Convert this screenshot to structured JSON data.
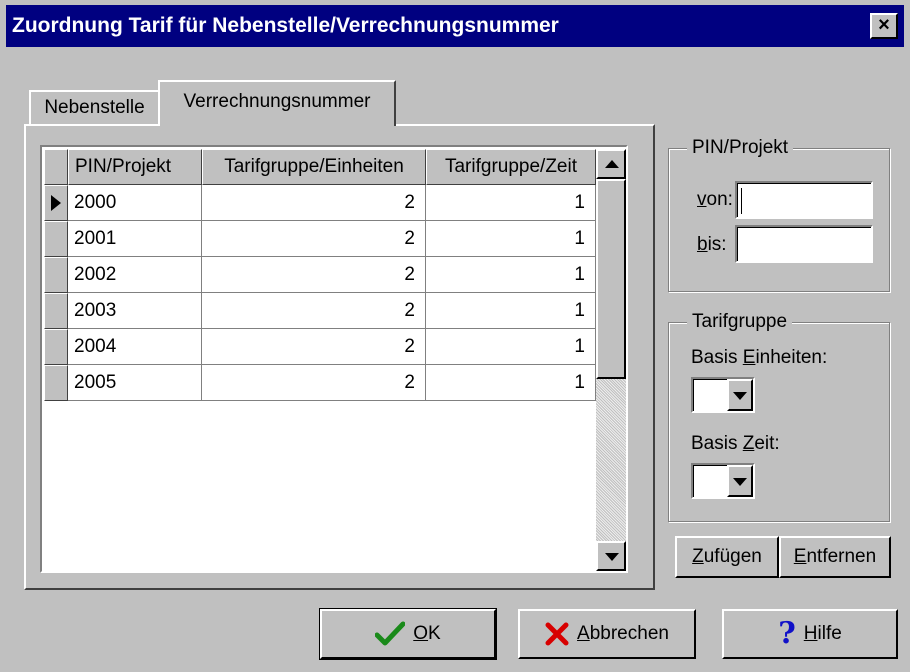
{
  "window": {
    "title": "Zuordnung Tarif für Nebenstelle/Verrechnungsnummer"
  },
  "tabs": [
    {
      "label": "Nebenstelle",
      "active": false
    },
    {
      "label": "Verrechnungsnummer",
      "active": true
    }
  ],
  "grid": {
    "columns": [
      "PIN/Projekt",
      "Tarifgruppe/Einheiten",
      "Tarifgruppe/Zeit"
    ],
    "rows": [
      {
        "pin": "2000",
        "einheiten": "2",
        "zeit": "1",
        "current": true
      },
      {
        "pin": "2001",
        "einheiten": "2",
        "zeit": "1",
        "current": false
      },
      {
        "pin": "2002",
        "einheiten": "2",
        "zeit": "1",
        "current": false
      },
      {
        "pin": "2003",
        "einheiten": "2",
        "zeit": "1",
        "current": false
      },
      {
        "pin": "2004",
        "einheiten": "2",
        "zeit": "1",
        "current": false
      },
      {
        "pin": "2005",
        "einheiten": "2",
        "zeit": "1",
        "current": false
      }
    ]
  },
  "pin_group": {
    "legend": "PIN/Projekt",
    "von": {
      "label_key": "v",
      "label_rest": "on:",
      "value": ""
    },
    "bis": {
      "label_key": "b",
      "label_rest": "is:",
      "value": ""
    }
  },
  "tarif_group": {
    "legend": "Tarifgruppe",
    "einheiten": {
      "label_pre": "Basis ",
      "label_key": "E",
      "label_rest": "inheiten:",
      "value": ""
    },
    "zeit": {
      "label_pre": "Basis ",
      "label_key": "Z",
      "label_rest": "eit:",
      "value": ""
    }
  },
  "actions": {
    "add": {
      "key": "Z",
      "rest": "ufügen"
    },
    "remove": {
      "key": "E",
      "rest": "ntfernen"
    }
  },
  "footer": {
    "ok": {
      "key": "O",
      "rest": "K"
    },
    "cancel": {
      "key": "A",
      "rest": "bbrechen"
    },
    "help": {
      "key": "H",
      "rest": "ilfe"
    }
  },
  "icons": {
    "close": "close-icon",
    "ok": "checkmark-icon",
    "cancel": "red-x-icon",
    "help": "question-mark-icon",
    "row_pointer": "row-pointer-icon"
  },
  "colors": {
    "titlebar": "#000080",
    "face": "#c0c0c0",
    "ok_check": "#1a8a1a",
    "cancel_x": "#d80000",
    "help_q": "#1010c8"
  }
}
